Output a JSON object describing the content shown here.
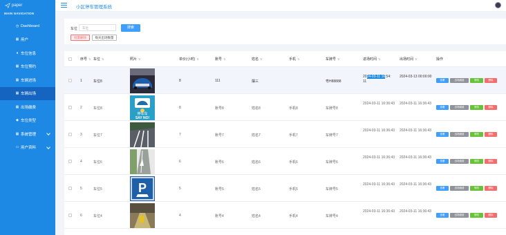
{
  "app": {
    "logo_text": "paper",
    "title": "小区停车管理系统"
  },
  "sidebar": {
    "heading": "MAIN NAVIGATION",
    "items": [
      {
        "label": "Dashboard",
        "icon": "dashboard-icon"
      },
      {
        "label": "用户",
        "icon": "grid-icon"
      },
      {
        "label": "车位信息",
        "icon": "user-icon"
      },
      {
        "label": "车位预约",
        "icon": "grid-icon"
      },
      {
        "label": "车辆进场",
        "icon": "grid-icon"
      },
      {
        "label": "车辆出场",
        "icon": "grid-icon",
        "active": true
      },
      {
        "label": "出场缴费",
        "icon": "grid-icon"
      },
      {
        "label": "车位类型",
        "icon": "tag-icon"
      },
      {
        "label": "系统管理",
        "icon": "grid-icon",
        "expandable": true
      },
      {
        "label": "用户资料",
        "icon": "folder-icon",
        "expandable": true
      }
    ]
  },
  "filter": {
    "label": "车位",
    "placeholder": "车位",
    "search": "搜索",
    "batch_delete": "批量删除",
    "daily_count": "每天出场数量"
  },
  "table": {
    "headers": [
      "序号",
      "车位",
      "照片",
      "单价(小时)",
      "账号",
      "姓名",
      "手机",
      "车牌号",
      "进场时间",
      "出场时间",
      "操作"
    ],
    "actions": [
      "查看",
      "出场缴费",
      "修改",
      "删除"
    ],
    "rows": [
      {
        "no": "1",
        "space": "车位8",
        "price": "8",
        "account": "111",
        "name": "摆三",
        "phone": "",
        "plate": "粤H88888",
        "in": "2024-03-11 16:54:11",
        "out": "2024-03-13 00:00:00",
        "highlight": true,
        "in_sel": "24-03-11 16"
      },
      {
        "no": "2",
        "space": "车位8",
        "price": "8",
        "account": "账号8",
        "name": "姓名8",
        "phone": "手机8",
        "plate": "车牌号8",
        "in": "2024-03-11 16:36:43",
        "out": "2024-03-11 16:36:43"
      },
      {
        "no": "3",
        "space": "车位7",
        "price": "7",
        "account": "账号7",
        "name": "姓名7",
        "phone": "手机7",
        "plate": "车牌号7",
        "in": "2024-03-11 16:36:43",
        "out": "2024-03-11 16:36:43"
      },
      {
        "no": "4",
        "space": "车位6",
        "price": "6",
        "account": "账号6",
        "name": "姓名6",
        "phone": "手机6",
        "plate": "车牌号6",
        "in": "2024-03-11 16:36:43",
        "out": "2024-03-11 16:36:43"
      },
      {
        "no": "5",
        "space": "车位5",
        "price": "5",
        "account": "账号5",
        "name": "姓名5",
        "phone": "手机5",
        "plate": "车牌号5",
        "in": "2024-03-11 16:36:43",
        "out": "2024-03-11 16:36:43"
      },
      {
        "no": "6",
        "space": "车位4",
        "price": "4",
        "account": "账号4",
        "name": "姓名4",
        "phone": "手机4",
        "plate": "车牌号4",
        "in": "2024-03-11 16:36:43",
        "out": "2024-03-11 16:36:43"
      }
    ],
    "photo_texts": {
      "2a": "停车车",
      "2b": "SAY NO!"
    }
  },
  "colors": {
    "primary": "#1e88e5",
    "active": "#1565c0",
    "view": "#409eff",
    "pay": "#909399",
    "edit": "#67c23a",
    "delete": "#f56c6c"
  }
}
